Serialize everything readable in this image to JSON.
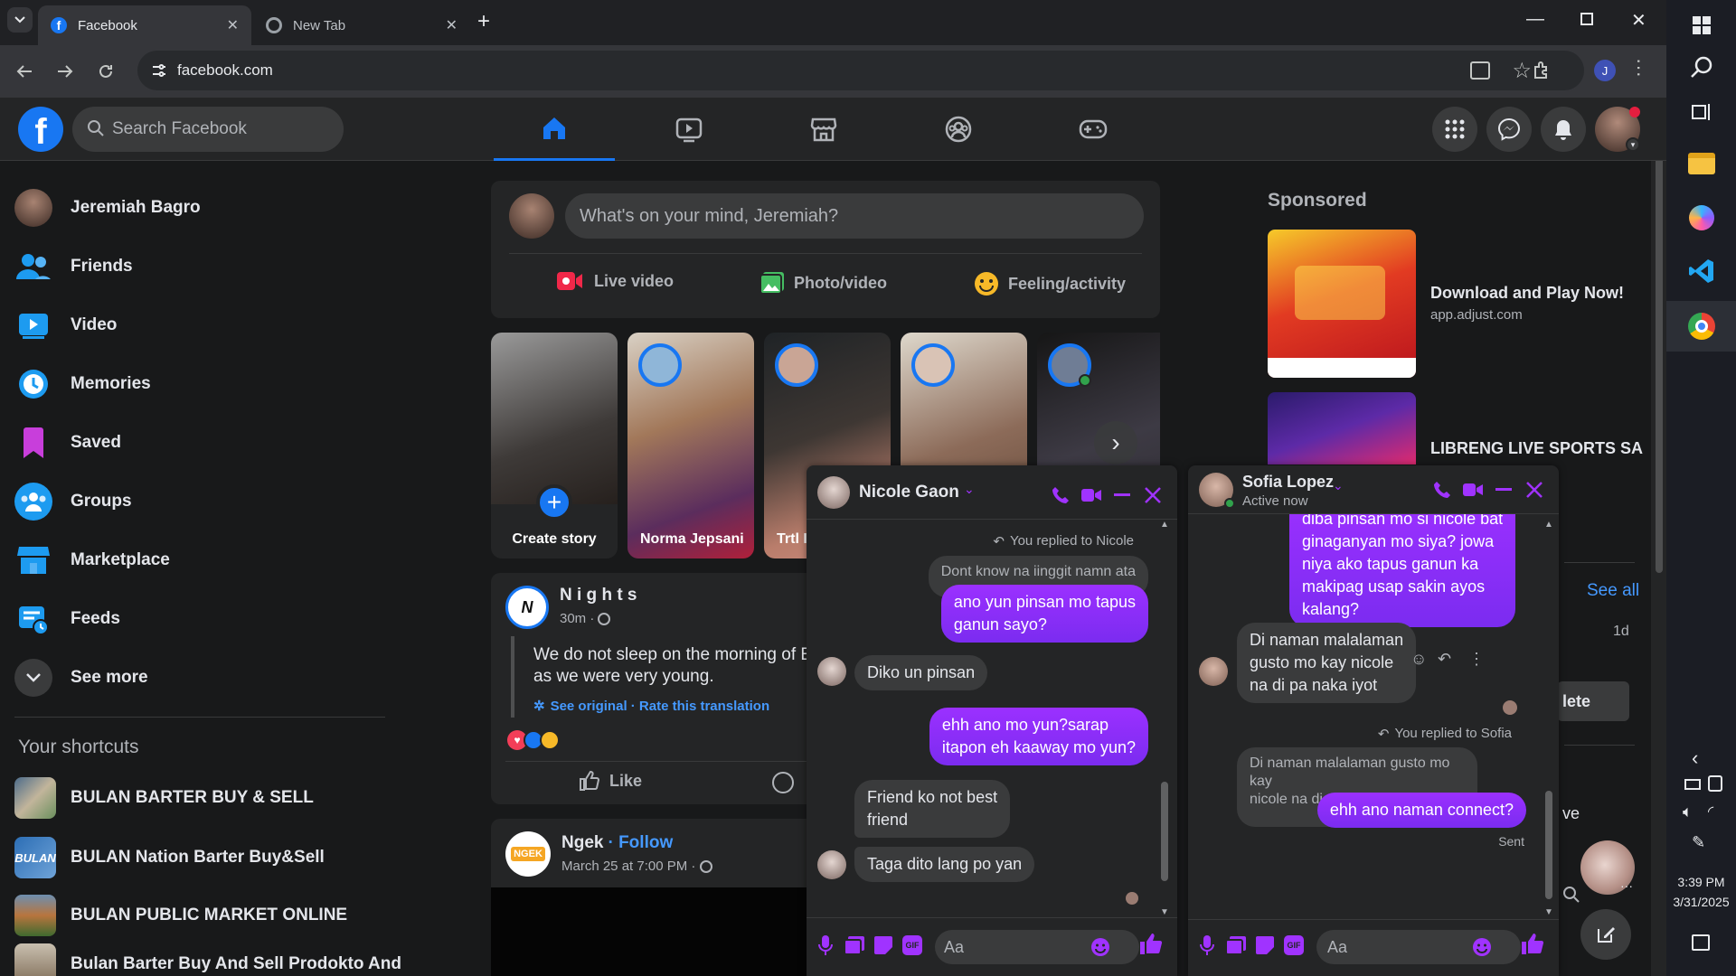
{
  "browser": {
    "tabs": [
      {
        "title": "Facebook",
        "active": true
      },
      {
        "title": "New Tab",
        "active": false
      }
    ],
    "url": "facebook.com",
    "profile_initial": "J"
  },
  "taskbar": {
    "time": "3:39 PM",
    "date": "3/31/2025"
  },
  "header": {
    "search_placeholder": "Search Facebook"
  },
  "sidebar": {
    "user": "Jeremiah Bagro",
    "items": [
      {
        "label": "Friends",
        "icon": "friends-icon"
      },
      {
        "label": "Video",
        "icon": "video-icon"
      },
      {
        "label": "Memories",
        "icon": "memories-icon"
      },
      {
        "label": "Saved",
        "icon": "saved-icon"
      },
      {
        "label": "Groups",
        "icon": "groups-icon"
      },
      {
        "label": "Marketplace",
        "icon": "marketplace-icon"
      },
      {
        "label": "Feeds",
        "icon": "feeds-icon"
      },
      {
        "label": "See more",
        "icon": "chevron-down-icon"
      }
    ],
    "shortcuts_title": "Your shortcuts",
    "shortcuts": [
      "BULAN BARTER BUY & SELL",
      "BULAN Nation Barter Buy&Sell",
      "BULAN PUBLIC MARKET ONLINE",
      "Bulan Barter Buy And Sell Prodokto And"
    ]
  },
  "composer": {
    "placeholder": "What's on your mind, Jeremiah?",
    "live": "Live video",
    "photo": "Photo/video",
    "feeling": "Feeling/activity"
  },
  "stories": [
    {
      "name": "Create story"
    },
    {
      "name": "Norma Jepsani"
    },
    {
      "name": "Trtl I"
    },
    {
      "name": ""
    },
    {
      "name": ""
    }
  ],
  "post1": {
    "author": "N i g h t s",
    "time": "30m ·",
    "text_line1": "We do not sleep on the morning of E",
    "text_line2": "as we were very young.",
    "see_original": "See original · Rate this translation",
    "like": "Like"
  },
  "post2": {
    "author": "Ngek",
    "follow": "· Follow",
    "time": "March 25 at 7:00 PM ·",
    "avatar_text": "NGEK"
  },
  "right": {
    "sponsored": "Sponsored",
    "ad1_title": "Download and Play Now!",
    "ad1_domain": "app.adjust.com",
    "ad2_title": "LIBRENG LIVE SPORTS SA",
    "see_all": "See all",
    "ago": "1d",
    "delete": "lete",
    "partial": "ve"
  },
  "chat1": {
    "name": "Nicole Gaon",
    "replied": "You replied to Nicole",
    "quoted": "Dont know na iinggit namn ata",
    "m1": [
      "ano yun pinsan mo tapus",
      "ganun sayo?"
    ],
    "m2": "Diko un pinsan",
    "m3": [
      "ehh ano mo yun?sarap",
      "itapon eh kaaway mo yun?"
    ],
    "m4": [
      "Friend ko not best",
      "friend"
    ],
    "m5": "Taga dito lang po yan",
    "input_placeholder": "Aa"
  },
  "chat2": {
    "name": "Sofia Lopez",
    "status": "Active now",
    "m1": [
      "diba pinsan mo si nicole bat",
      "ginaganyan mo siya? jowa",
      "niya ako tapus ganun ka",
      "makipag usap sakin ayos",
      "kalang?"
    ],
    "m2": [
      "Di naman malalaman",
      "gusto mo  kay nicole",
      "na di pa naka iyot"
    ],
    "replied": "You replied to Sofia",
    "quoted": [
      "Di naman malalaman  gusto mo  kay",
      "nicole na di pa naka iyot"
    ],
    "m3": "ehh ano naman connect?",
    "sent": "Sent",
    "input_placeholder": "Aa"
  },
  "colors": {
    "fb_blue": "#1877f2",
    "messenger_purple": "#9b30ff",
    "chat_icon_purple": "#a033ff"
  }
}
